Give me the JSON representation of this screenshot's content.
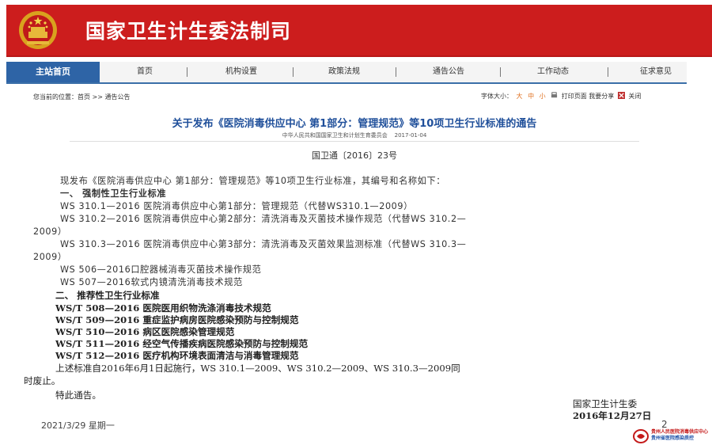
{
  "header": {
    "title": "国家卫生计生委法制司",
    "emblem_icon": "national-emblem-icon",
    "brand_color": "#cc1d1d"
  },
  "nav": {
    "home": "主站首页",
    "items": [
      "首页",
      "机构设置",
      "政策法规",
      "通告公告",
      "工作动态",
      "征求意见"
    ],
    "separator": "|"
  },
  "breadcrumb": {
    "label": "您当前的位置：",
    "path": "首页 >> 通告公告"
  },
  "toolbar": {
    "font_size_label": "字体大小：",
    "sizes": [
      "大",
      "中",
      "小"
    ],
    "print_label": "打印页面",
    "share_label": "我要分享",
    "close_label": "关闭"
  },
  "article": {
    "title": "关于发布《医院消毒供应中心 第1部分：管理规范》等10项卫生行业标准的通告",
    "publisher": "中华人民共和国国家卫生和计划生育委员会",
    "date": "2017-01-04",
    "doc_number": "国卫通〔2016〕23号",
    "intro": "现发布《医院消毒供应中心 第1部分：管理规范》等10项卫生行业标准，其编号和名称如下：",
    "section1": "一、  强制性卫生行业标准",
    "lines": [
      "WS 310.1—2016 医院消毒供应中心第1部分：管理规范（代替WS310.1—2009）",
      "WS 310.2—2016 医院消毒供应中心第2部分：清洗消毒及灭菌技术操作规范（代替WS 310.2—",
      "2009）",
      "WS 310.3—2016 医院消毒供应中心第3部分：清洗消毒及灭菌效果监测标准（代替WS 310.3—",
      "2009）",
      "WS 506—2016口腔器械消毒灭菌技术操作规范",
      "WS 507—2016软式内镜清洗消毒技术规范"
    ]
  },
  "slide": {
    "section2": "二、 推荐性卫生行业标准",
    "items": [
      "WS/T 508—2016 医院医用织物洗涤消毒技术规范",
      "WS/T 509—2016 重症监护病房医院感染预防与控制规范",
      "WS/T 510—2016 病区医院感染管理规范",
      "WS/T 511—2016 经空气传播疾病医院感染预防与控制规范",
      "WS/T 512—2016 医疗机构环境表面清洁与消毒管理规范"
    ],
    "effective_1": "上述标准自2016年6月1日起施行，WS 310.1—2009、WS 310.2—2009、WS 310.3—2009同",
    "effective_2": "时废止。",
    "closing": "特此通告。",
    "signature_org": "国家卫生计生委",
    "signature_date": "2016年12月27日"
  },
  "footer": {
    "date": "2021/3/29 星期一",
    "page": "2",
    "logo_line1": "贵州人民医院消毒供应中心",
    "logo_line2": "贵州省医院感染质控"
  }
}
